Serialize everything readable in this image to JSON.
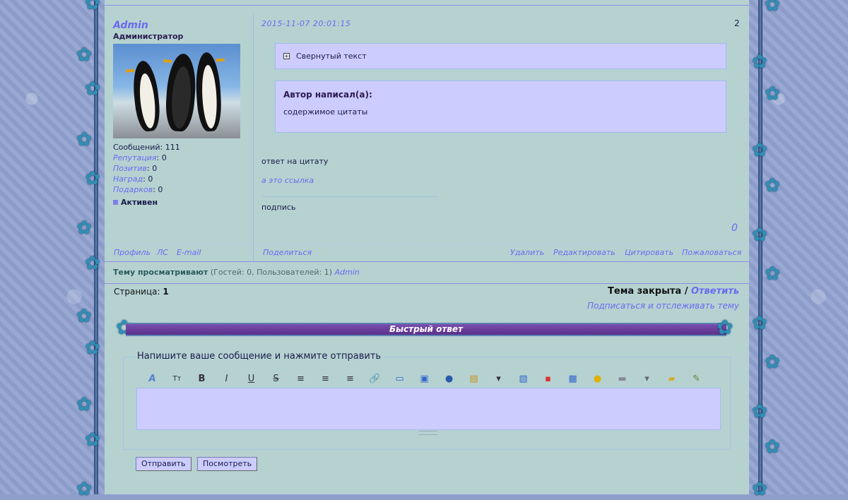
{
  "post": {
    "username": "Admin",
    "rank": "Администратор",
    "stats": [
      {
        "key": "Сообщений",
        "sep": ": ",
        "value": "111",
        "link": false
      },
      {
        "key": "Репутация",
        "sep": ": ",
        "value": "0",
        "link": true
      },
      {
        "key": "Позитив",
        "sep": ": ",
        "value": "0",
        "link": true
      },
      {
        "key": "Наград",
        "sep": ": ",
        "value": "0",
        "link": true
      },
      {
        "key": "Подарков",
        "sep": ": ",
        "value": "0",
        "link": true
      }
    ],
    "status": "Активен",
    "date": "2015-11-07 20:01:15",
    "number": "2",
    "spoiler_label": "Свернутый текст",
    "quote_header": "Автор написал(а):",
    "quote_body": "содержимое цитаты",
    "body_text": "ответ на цитату",
    "link_text": "а это ссылка",
    "signature": "подпись",
    "rating": "0"
  },
  "user_actions": {
    "profile": "Профиль",
    "pm": "ЛС",
    "email": "E-mail"
  },
  "share": "Поделиться",
  "post_actions": {
    "delete": "Удалить",
    "edit": "Редактировать",
    "quote": "Цитировать",
    "report": "Пожаловаться"
  },
  "viewers": {
    "label": "Тему просматривают",
    "detail": "(Гостей: 0, Пользователей: 1)",
    "user": "Admin"
  },
  "pagination": {
    "label": "Страница:",
    "current": "1"
  },
  "topic": {
    "closed": "Тема закрыта",
    "slash": "/",
    "reply": "Ответить",
    "subscribe": "Подписаться и отслеживать тему"
  },
  "quick_reply": {
    "title": "Быстрый ответ",
    "legend": "Напишите ваше сообщение и нажмите отправить",
    "submit": "Отправить",
    "preview": "Посмотреть"
  },
  "toolbar_icons": [
    "font-icon",
    "font-size-icon",
    "bold-icon",
    "italic-icon",
    "underline-icon",
    "strikethrough-icon",
    "align-left-icon",
    "align-center-icon",
    "align-right-icon",
    "link-icon",
    "image-icon",
    "media-icon",
    "video-icon",
    "hide-icon",
    "quote-icon",
    "code-icon",
    "color-icon",
    "table-icon",
    "smiley-icon",
    "keyboard-icon",
    "more-icon",
    "upload-icon",
    "spellcheck-icon"
  ],
  "colors": {
    "accent": "#6a6af0",
    "panel": "#ccccff",
    "content_bg": "#b5d2d1",
    "bar": "#5a2f88"
  }
}
